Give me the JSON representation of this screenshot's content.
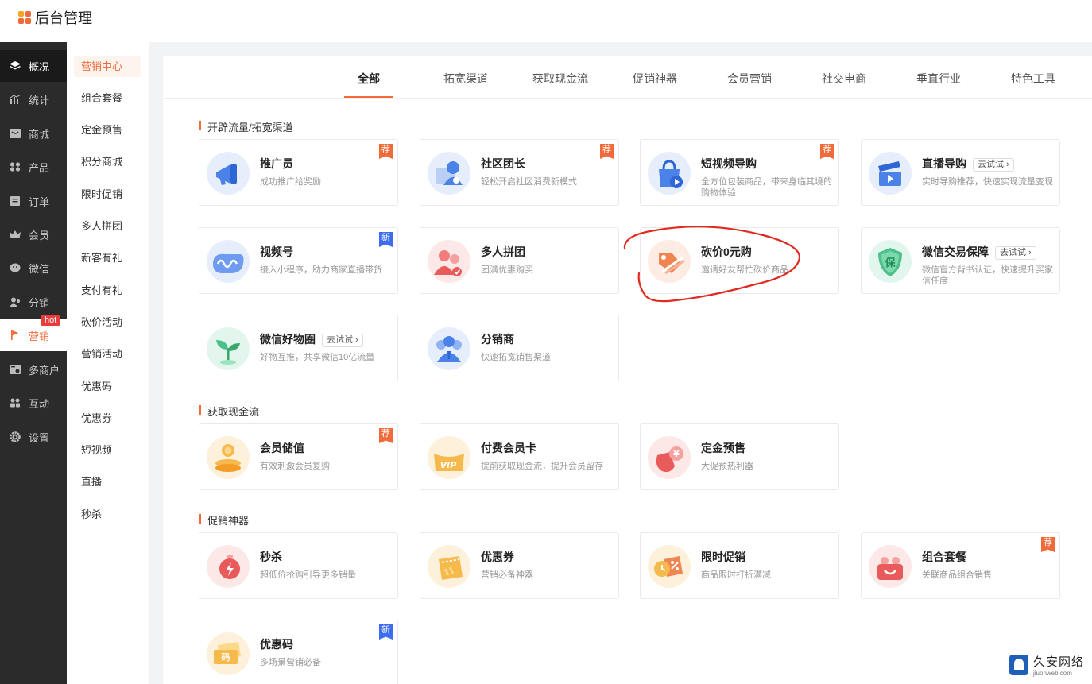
{
  "app": {
    "title": "后台管理"
  },
  "sidebar": {
    "items": [
      {
        "label": "概况",
        "icon": "layers-icon"
      },
      {
        "label": "统计",
        "icon": "chart-icon"
      },
      {
        "label": "商城",
        "icon": "store-icon"
      },
      {
        "label": "产品",
        "icon": "grid-icon"
      },
      {
        "label": "订单",
        "icon": "order-icon"
      },
      {
        "label": "会员",
        "icon": "crown-icon"
      },
      {
        "label": "微信",
        "icon": "wechat-icon"
      },
      {
        "label": "分销",
        "icon": "users-icon"
      },
      {
        "label": "营销",
        "icon": "flag-icon",
        "badge": "hot"
      },
      {
        "label": "多商户",
        "icon": "merchant-icon"
      },
      {
        "label": "互动",
        "icon": "interact-icon"
      },
      {
        "label": "设置",
        "icon": "gear-icon"
      }
    ]
  },
  "subnav": {
    "items": [
      "营销中心",
      "组合套餐",
      "定金预售",
      "积分商城",
      "限时促销",
      "多人拼团",
      "新客有礼",
      "支付有礼",
      "砍价活动",
      "营销活动",
      "优惠码",
      "优惠券",
      "短视频",
      "直播",
      "秒杀"
    ]
  },
  "tabs": [
    "全部",
    "拓宽渠道",
    "获取现金流",
    "促销神器",
    "会员营销",
    "社交电商",
    "垂直行业",
    "特色工具"
  ],
  "sections": [
    {
      "title": "开辟流量/拓宽渠道",
      "cards": [
        {
          "title": "推广员",
          "desc": "成功推广给奖励",
          "badge": "荐"
        },
        {
          "title": "社区团长",
          "desc": "轻松开启社区消费新模式",
          "badge": "荐"
        },
        {
          "title": "短视频导购",
          "desc": "全方位包装商品，带来身临其境的购物体验",
          "badge": "荐"
        },
        {
          "title": "直播导购",
          "desc": "实时导购推荐，快速实现流量变现",
          "try": "去试试"
        },
        {
          "title": "视频号",
          "desc": "接入小程序，助力商家直播带货",
          "badge": "新"
        },
        {
          "title": "多人拼团",
          "desc": "团满优惠购买"
        },
        {
          "title": "砍价0元购",
          "desc": "邀请好友帮忙砍价商品"
        },
        {
          "title": "微信交易保障",
          "desc": "微信官方背书认证，快速提升买家信任度",
          "try": "去试试"
        },
        {
          "title": "微信好物圈",
          "desc": "好物互推，共享微信10亿流量",
          "try": "去试试"
        },
        {
          "title": "分销商",
          "desc": "快速拓宽销售渠道"
        }
      ]
    },
    {
      "title": "获取现金流",
      "cards": [
        {
          "title": "会员储值",
          "desc": "有效刺激会员复购",
          "badge": "荐"
        },
        {
          "title": "付费会员卡",
          "desc": "提前获取现金流，提升会员留存"
        },
        {
          "title": "定金预售",
          "desc": "大促预热利器"
        }
      ]
    },
    {
      "title": "促销神器",
      "cards": [
        {
          "title": "秒杀",
          "desc": "超低价抢购引导更多销量"
        },
        {
          "title": "优惠券",
          "desc": "营销必备神器"
        },
        {
          "title": "限时促销",
          "desc": "商品限时打折满减"
        },
        {
          "title": "组合套餐",
          "desc": "关联商品组合销售",
          "badge": "荐"
        },
        {
          "title": "优惠码",
          "desc": "多场景营销必备",
          "badge": "新"
        }
      ]
    }
  ],
  "icon_text": {
    "bao": "保",
    "ma": "码",
    "vip": "VIP",
    "yen": "¥"
  },
  "watermark": {
    "cn": "久安网络",
    "en": "jiuonweb.com"
  },
  "colors": {
    "accent": "#f06a3a",
    "sidebar_bg": "#2b2b2b",
    "new_badge": "#3d6cf0",
    "hot_badge": "#e93c3c"
  }
}
